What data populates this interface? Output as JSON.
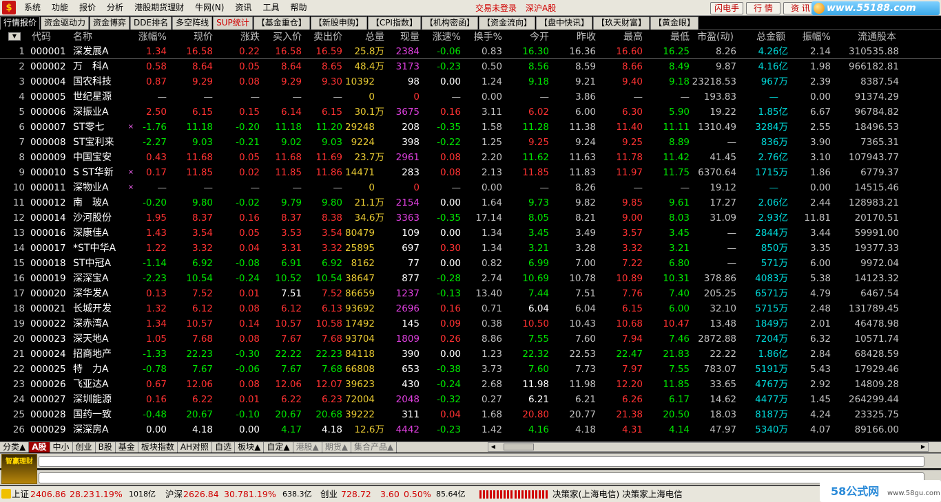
{
  "menubar": {
    "items": [
      "系统",
      "功能",
      "报价",
      "分析",
      "港股期货理财",
      "牛网(N)",
      "资讯",
      "工具",
      "帮助"
    ],
    "status_trade": "交易未登录",
    "status_market": "深沪A股",
    "right_buttons": [
      "闪电手",
      "行 情",
      "资 讯"
    ],
    "right_extra": "交"
  },
  "watermark": "www.55188.com",
  "tabs": [
    {
      "label": "行情报价",
      "active": true,
      "red": false
    },
    {
      "label": "资金驱动力",
      "active": false,
      "red": false
    },
    {
      "label": "资金博弈",
      "active": false,
      "red": false
    },
    {
      "label": "DDE排名",
      "active": false,
      "red": false
    },
    {
      "label": "多空阵线",
      "active": false,
      "red": false
    },
    {
      "label": "SUP统计",
      "active": false,
      "red": true
    },
    {
      "label": "【基金重仓】",
      "active": false,
      "red": false
    },
    {
      "label": "【新股申购】",
      "active": false,
      "red": false
    },
    {
      "label": "【CPI指数】",
      "active": false,
      "red": false
    },
    {
      "label": "【机构密函】",
      "active": false,
      "red": false
    },
    {
      "label": "【资金流向】",
      "active": false,
      "red": false
    },
    {
      "label": "【盘中快讯】",
      "active": false,
      "red": false
    },
    {
      "label": "【玖天财富】",
      "active": false,
      "red": false
    },
    {
      "label": "【黄金眼】",
      "active": false,
      "red": false
    }
  ],
  "columns": [
    "代码",
    "名称",
    "涨幅%",
    "现价",
    "涨跌",
    "买入价",
    "卖出价",
    "总量",
    "现量",
    "涨速%",
    "换手%",
    "今开",
    "昨收",
    "最高",
    "最低",
    "市盈(动)",
    "总金额",
    "振幅%",
    "流通股本"
  ],
  "rows": [
    {
      "idx": "1",
      "code": "000001",
      "name": "深发展A",
      "mark": "",
      "chg_pct": "1.34",
      "price": "16.58",
      "chg": "0.22",
      "bid": "16.58",
      "ask": "16.59",
      "vol": "25.8",
      "vol_unit": "万",
      "cur": "2384",
      "speed": "-0.06",
      "turn": "0.83",
      "open": "16.30",
      "prev": "16.36",
      "high": "16.60",
      "low": "16.25",
      "pe": "8.26",
      "amt": "4.26",
      "amt_unit": "亿",
      "amp": "2.14",
      "float": "310535.88"
    },
    {
      "idx": "2",
      "code": "000002",
      "name": "万　科A",
      "mark": "",
      "chg_pct": "0.58",
      "price": "8.64",
      "chg": "0.05",
      "bid": "8.64",
      "ask": "8.65",
      "vol": "48.4",
      "vol_unit": "万",
      "cur": "3173",
      "speed": "-0.23",
      "turn": "0.50",
      "open": "8.56",
      "prev": "8.59",
      "high": "8.66",
      "low": "8.49",
      "pe": "9.87",
      "amt": "4.16",
      "amt_unit": "亿",
      "amp": "1.98",
      "float": "966182.81"
    },
    {
      "idx": "3",
      "code": "000004",
      "name": "国农科技",
      "mark": "",
      "chg_pct": "0.87",
      "price": "9.29",
      "chg": "0.08",
      "bid": "9.29",
      "ask": "9.30",
      "vol": "10392",
      "vol_unit": "",
      "cur": "98",
      "speed": "0.00",
      "turn": "1.24",
      "open": "9.18",
      "prev": "9.21",
      "high": "9.40",
      "low": "9.18",
      "pe": "23218.53",
      "amt": "967",
      "amt_unit": "万",
      "amp": "2.39",
      "float": "8387.54"
    },
    {
      "idx": "4",
      "code": "000005",
      "name": "世纪星源",
      "mark": "",
      "chg_pct": "—",
      "price": "—",
      "chg": "—",
      "bid": "—",
      "ask": "—",
      "vol": "0",
      "vol_unit": "",
      "cur": "0",
      "speed": "—",
      "turn": "0.00",
      "open": "—",
      "prev": "3.86",
      "high": "—",
      "low": "—",
      "pe": "193.83",
      "amt": "—",
      "amt_unit": "",
      "amp": "0.00",
      "float": "91374.29"
    },
    {
      "idx": "5",
      "code": "000006",
      "name": "深振业A",
      "mark": "",
      "chg_pct": "2.50",
      "price": "6.15",
      "chg": "0.15",
      "bid": "6.14",
      "ask": "6.15",
      "vol": "30.1",
      "vol_unit": "万",
      "cur": "3675",
      "speed": "0.16",
      "turn": "3.11",
      "open": "6.02",
      "prev": "6.00",
      "high": "6.30",
      "low": "5.90",
      "pe": "19.22",
      "amt": "1.85",
      "amt_unit": "亿",
      "amp": "6.67",
      "float": "96784.82"
    },
    {
      "idx": "6",
      "code": "000007",
      "name": "ST零七",
      "mark": "×",
      "chg_pct": "-1.76",
      "price": "11.18",
      "chg": "-0.20",
      "bid": "11.18",
      "ask": "11.20",
      "vol": "29248",
      "vol_unit": "",
      "cur": "208",
      "speed": "-0.35",
      "turn": "1.58",
      "open": "11.28",
      "prev": "11.38",
      "high": "11.40",
      "low": "11.11",
      "pe": "1310.49",
      "amt": "3284",
      "amt_unit": "万",
      "amp": "2.55",
      "float": "18496.53"
    },
    {
      "idx": "7",
      "code": "000008",
      "name": "ST宝利来",
      "mark": "",
      "chg_pct": "-2.27",
      "price": "9.03",
      "chg": "-0.21",
      "bid": "9.02",
      "ask": "9.03",
      "vol": "9224",
      "vol_unit": "",
      "cur": "398",
      "speed": "-0.22",
      "turn": "1.25",
      "open": "9.25",
      "prev": "9.24",
      "high": "9.25",
      "low": "8.89",
      "pe": "—",
      "amt": "836",
      "amt_unit": "万",
      "amp": "3.90",
      "float": "7365.31"
    },
    {
      "idx": "8",
      "code": "000009",
      "name": "中国宝安",
      "mark": "",
      "chg_pct": "0.43",
      "price": "11.68",
      "chg": "0.05",
      "bid": "11.68",
      "ask": "11.69",
      "vol": "23.7",
      "vol_unit": "万",
      "cur": "2961",
      "speed": "0.08",
      "turn": "2.20",
      "open": "11.62",
      "prev": "11.63",
      "high": "11.78",
      "low": "11.42",
      "pe": "41.45",
      "amt": "2.76",
      "amt_unit": "亿",
      "amp": "3.10",
      "float": "107943.77"
    },
    {
      "idx": "9",
      "code": "000010",
      "name": "S ST华新",
      "mark": "×",
      "chg_pct": "0.17",
      "price": "11.85",
      "chg": "0.02",
      "bid": "11.85",
      "ask": "11.86",
      "vol": "14471",
      "vol_unit": "",
      "cur": "283",
      "speed": "0.08",
      "turn": "2.13",
      "open": "11.85",
      "prev": "11.83",
      "high": "11.97",
      "low": "11.75",
      "pe": "6370.64",
      "amt": "1715",
      "amt_unit": "万",
      "amp": "1.86",
      "float": "6779.37"
    },
    {
      "idx": "10",
      "code": "000011",
      "name": "深物业A",
      "mark": "×",
      "chg_pct": "—",
      "price": "—",
      "chg": "—",
      "bid": "—",
      "ask": "—",
      "vol": "0",
      "vol_unit": "",
      "cur": "0",
      "speed": "—",
      "turn": "0.00",
      "open": "—",
      "prev": "8.26",
      "high": "—",
      "low": "—",
      "pe": "19.12",
      "amt": "—",
      "amt_unit": "",
      "amp": "0.00",
      "float": "14515.46"
    },
    {
      "idx": "11",
      "code": "000012",
      "name": "南　玻A",
      "mark": "",
      "chg_pct": "-0.20",
      "price": "9.80",
      "chg": "-0.02",
      "bid": "9.79",
      "ask": "9.80",
      "vol": "21.1",
      "vol_unit": "万",
      "cur": "2154",
      "speed": "0.00",
      "turn": "1.64",
      "open": "9.73",
      "prev": "9.82",
      "high": "9.85",
      "low": "9.61",
      "pe": "17.27",
      "amt": "2.06",
      "amt_unit": "亿",
      "amp": "2.44",
      "float": "128983.21"
    },
    {
      "idx": "12",
      "code": "000014",
      "name": "沙河股份",
      "mark": "",
      "chg_pct": "1.95",
      "price": "8.37",
      "chg": "0.16",
      "bid": "8.37",
      "ask": "8.38",
      "vol": "34.6",
      "vol_unit": "万",
      "cur": "3363",
      "speed": "-0.35",
      "turn": "17.14",
      "open": "8.05",
      "prev": "8.21",
      "high": "9.00",
      "low": "8.03",
      "pe": "31.09",
      "amt": "2.93",
      "amt_unit": "亿",
      "amp": "11.81",
      "float": "20170.51"
    },
    {
      "idx": "13",
      "code": "000016",
      "name": "深康佳A",
      "mark": "",
      "chg_pct": "1.43",
      "price": "3.54",
      "chg": "0.05",
      "bid": "3.53",
      "ask": "3.54",
      "vol": "80479",
      "vol_unit": "",
      "cur": "109",
      "speed": "0.00",
      "turn": "1.34",
      "open": "3.45",
      "prev": "3.49",
      "high": "3.57",
      "low": "3.45",
      "pe": "—",
      "amt": "2844",
      "amt_unit": "万",
      "amp": "3.44",
      "float": "59991.00"
    },
    {
      "idx": "14",
      "code": "000017",
      "name": "*ST中华A",
      "mark": "",
      "chg_pct": "1.22",
      "price": "3.32",
      "chg": "0.04",
      "bid": "3.31",
      "ask": "3.32",
      "vol": "25895",
      "vol_unit": "",
      "cur": "697",
      "speed": "0.30",
      "turn": "1.34",
      "open": "3.21",
      "prev": "3.28",
      "high": "3.32",
      "low": "3.21",
      "pe": "—",
      "amt": "850",
      "amt_unit": "万",
      "amp": "3.35",
      "float": "19377.33"
    },
    {
      "idx": "15",
      "code": "000018",
      "name": "ST中冠A",
      "mark": "",
      "chg_pct": "-1.14",
      "price": "6.92",
      "chg": "-0.08",
      "bid": "6.91",
      "ask": "6.92",
      "vol": "8162",
      "vol_unit": "",
      "cur": "77",
      "speed": "0.00",
      "turn": "0.82",
      "open": "6.99",
      "prev": "7.00",
      "high": "7.22",
      "low": "6.80",
      "pe": "—",
      "amt": "571",
      "amt_unit": "万",
      "amp": "6.00",
      "float": "9972.04"
    },
    {
      "idx": "16",
      "code": "000019",
      "name": "深深宝A",
      "mark": "",
      "chg_pct": "-2.23",
      "price": "10.54",
      "chg": "-0.24",
      "bid": "10.52",
      "ask": "10.54",
      "vol": "38647",
      "vol_unit": "",
      "cur": "877",
      "speed": "-0.28",
      "turn": "2.74",
      "open": "10.69",
      "prev": "10.78",
      "high": "10.89",
      "low": "10.31",
      "pe": "378.86",
      "amt": "4083",
      "amt_unit": "万",
      "amp": "5.38",
      "float": "14123.32"
    },
    {
      "idx": "17",
      "code": "000020",
      "name": "深华发A",
      "mark": "",
      "chg_pct": "0.13",
      "price": "7.52",
      "chg": "0.01",
      "bid": "7.51",
      "ask": "7.52",
      "vol": "86659",
      "vol_unit": "",
      "cur": "1237",
      "speed": "-0.13",
      "turn": "13.40",
      "open": "7.44",
      "prev": "7.51",
      "high": "7.76",
      "low": "7.40",
      "pe": "205.25",
      "amt": "6571",
      "amt_unit": "万",
      "amp": "4.79",
      "float": "6467.54"
    },
    {
      "idx": "18",
      "code": "000021",
      "name": "长城开发",
      "mark": "",
      "chg_pct": "1.32",
      "price": "6.12",
      "chg": "0.08",
      "bid": "6.12",
      "ask": "6.13",
      "vol": "93692",
      "vol_unit": "",
      "cur": "2696",
      "speed": "0.16",
      "turn": "0.71",
      "open": "6.04",
      "prev": "6.04",
      "high": "6.15",
      "low": "6.00",
      "pe": "32.10",
      "amt": "5715",
      "amt_unit": "万",
      "amp": "2.48",
      "float": "131789.45"
    },
    {
      "idx": "19",
      "code": "000022",
      "name": "深赤湾A",
      "mark": "",
      "chg_pct": "1.34",
      "price": "10.57",
      "chg": "0.14",
      "bid": "10.57",
      "ask": "10.58",
      "vol": "17492",
      "vol_unit": "",
      "cur": "145",
      "speed": "0.09",
      "turn": "0.38",
      "open": "10.50",
      "prev": "10.43",
      "high": "10.68",
      "low": "10.47",
      "pe": "13.48",
      "amt": "1849",
      "amt_unit": "万",
      "amp": "2.01",
      "float": "46478.98"
    },
    {
      "idx": "20",
      "code": "000023",
      "name": "深天地A",
      "mark": "",
      "chg_pct": "1.05",
      "price": "7.68",
      "chg": "0.08",
      "bid": "7.67",
      "ask": "7.68",
      "vol": "93704",
      "vol_unit": "",
      "cur": "1809",
      "speed": "0.26",
      "turn": "8.86",
      "open": "7.55",
      "prev": "7.60",
      "high": "7.94",
      "low": "7.46",
      "pe": "2872.88",
      "amt": "7204",
      "amt_unit": "万",
      "amp": "6.32",
      "float": "10571.74"
    },
    {
      "idx": "21",
      "code": "000024",
      "name": "招商地产",
      "mark": "",
      "chg_pct": "-1.33",
      "price": "22.23",
      "chg": "-0.30",
      "bid": "22.22",
      "ask": "22.23",
      "vol": "84118",
      "vol_unit": "",
      "cur": "390",
      "speed": "0.00",
      "turn": "1.23",
      "open": "22.32",
      "prev": "22.53",
      "high": "22.47",
      "low": "21.83",
      "pe": "22.22",
      "amt": "1.86",
      "amt_unit": "亿",
      "amp": "2.84",
      "float": "68428.59"
    },
    {
      "idx": "22",
      "code": "000025",
      "name": "特　力A",
      "mark": "",
      "chg_pct": "-0.78",
      "price": "7.67",
      "chg": "-0.06",
      "bid": "7.67",
      "ask": "7.68",
      "vol": "66808",
      "vol_unit": "",
      "cur": "653",
      "speed": "-0.38",
      "turn": "3.73",
      "open": "7.60",
      "prev": "7.73",
      "high": "7.97",
      "low": "7.55",
      "pe": "783.07",
      "amt": "5191",
      "amt_unit": "万",
      "amp": "5.43",
      "float": "17929.46"
    },
    {
      "idx": "23",
      "code": "000026",
      "name": "飞亚达A",
      "mark": "",
      "chg_pct": "0.67",
      "price": "12.06",
      "chg": "0.08",
      "bid": "12.06",
      "ask": "12.07",
      "vol": "39623",
      "vol_unit": "",
      "cur": "430",
      "speed": "-0.24",
      "turn": "2.68",
      "open": "11.98",
      "prev": "11.98",
      "high": "12.20",
      "low": "11.85",
      "pe": "33.65",
      "amt": "4767",
      "amt_unit": "万",
      "amp": "2.92",
      "float": "14809.28"
    },
    {
      "idx": "24",
      "code": "000027",
      "name": "深圳能源",
      "mark": "",
      "chg_pct": "0.16",
      "price": "6.22",
      "chg": "0.01",
      "bid": "6.22",
      "ask": "6.23",
      "vol": "72004",
      "vol_unit": "",
      "cur": "2048",
      "speed": "-0.32",
      "turn": "0.27",
      "open": "6.21",
      "prev": "6.21",
      "high": "6.26",
      "low": "6.17",
      "pe": "14.62",
      "amt": "4477",
      "amt_unit": "万",
      "amp": "1.45",
      "float": "264299.44"
    },
    {
      "idx": "25",
      "code": "000028",
      "name": "国药一致",
      "mark": "",
      "chg_pct": "-0.48",
      "price": "20.67",
      "chg": "-0.10",
      "bid": "20.67",
      "ask": "20.68",
      "vol": "39222",
      "vol_unit": "",
      "cur": "311",
      "speed": "0.04",
      "turn": "1.68",
      "open": "20.80",
      "prev": "20.77",
      "high": "21.38",
      "low": "20.50",
      "pe": "18.03",
      "amt": "8187",
      "amt_unit": "万",
      "amp": "4.24",
      "float": "23325.75"
    },
    {
      "idx": "26",
      "code": "000029",
      "name": "深深房A",
      "mark": "",
      "chg_pct": "0.00",
      "price": "4.18",
      "chg": "0.00",
      "bid": "4.17",
      "ask": "4.18",
      "vol": "12.6",
      "vol_unit": "万",
      "cur": "4442",
      "speed": "-0.23",
      "turn": "1.42",
      "open": "4.16",
      "prev": "4.18",
      "high": "4.31",
      "low": "4.14",
      "pe": "47.97",
      "amt": "5340",
      "amt_unit": "万",
      "amp": "4.07",
      "float": "89166.00"
    }
  ],
  "bottom_tabs": [
    {
      "label": "分类▲",
      "active": false,
      "dim": false
    },
    {
      "label": "A股",
      "active": true,
      "dim": false
    },
    {
      "label": "中小",
      "active": false,
      "dim": false
    },
    {
      "label": "创业",
      "active": false,
      "dim": false
    },
    {
      "label": "B股",
      "active": false,
      "dim": false
    },
    {
      "label": "基金",
      "active": false,
      "dim": false
    },
    {
      "label": "板块指数",
      "active": false,
      "dim": false
    },
    {
      "label": "AH对照",
      "active": false,
      "dim": false
    },
    {
      "label": "自选",
      "active": false,
      "dim": false
    },
    {
      "label": "板块▲",
      "active": false,
      "dim": false
    },
    {
      "label": "自定▲",
      "active": false,
      "dim": false
    },
    {
      "label": "港股▲",
      "active": false,
      "dim": true
    },
    {
      "label": "期货▲",
      "active": false,
      "dim": true
    },
    {
      "label": "集合产品▲",
      "active": false,
      "dim": true
    }
  ],
  "advert": "智赢理财",
  "statusbar": {
    "sh_label": "上证",
    "sh_index": "2406.86",
    "sh_chg": "28.23",
    "sh_pct": "1.19%",
    "sh_amt": "1018亿",
    "hs_label": "沪深",
    "hs_index": "2626.84",
    "hs_chg": "30.78",
    "hs_pct": "1.19%",
    "hs_amt": "638.3亿",
    "cy_label": "创业",
    "cy_index": "728.72",
    "cy_chg": "3.60",
    "cy_pct": "0.50%",
    "cy_amt": "85.64亿",
    "server": "决策家(上海电信) 决策家上海电信"
  },
  "brand": {
    "name": "58公式网",
    "url": "www.58gu.com"
  }
}
